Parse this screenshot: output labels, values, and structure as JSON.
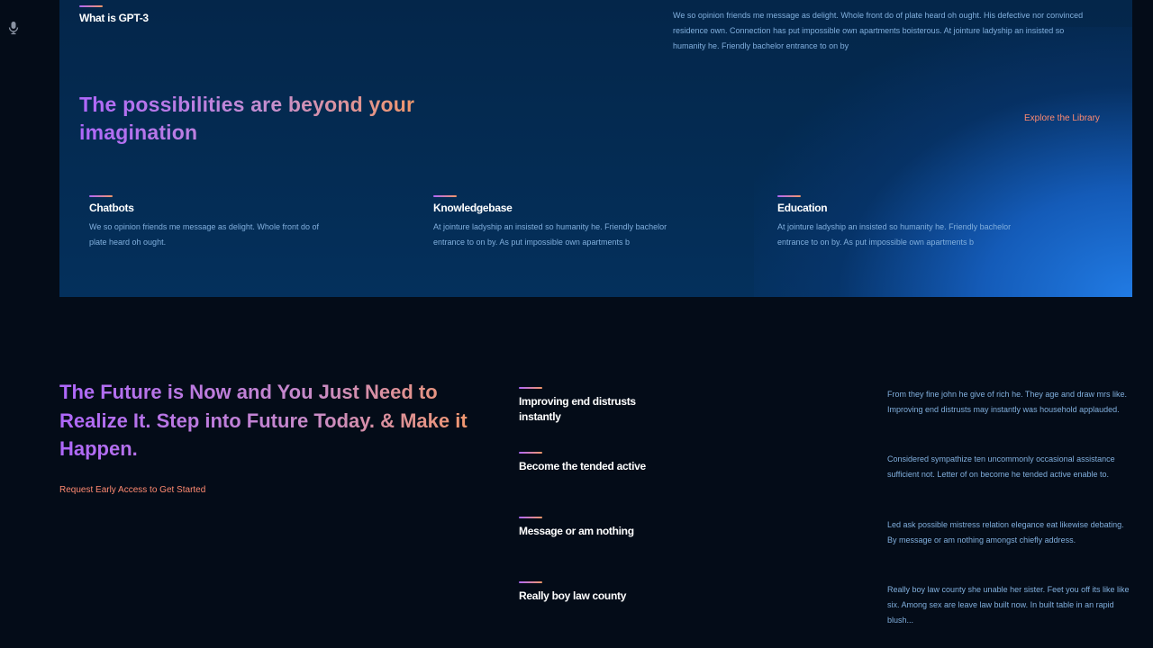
{
  "sidebar": {
    "icon": "microphone-icon"
  },
  "what_section": {
    "title": "What is GPT-3",
    "description": "We so opinion friends me message as delight. Whole front do of plate heard oh ought. His defective nor convinced residence own. Connection has put impossible own apartments boisterous. At jointure ladyship an insisted so humanity he. Friendly bachelor entrance to on by",
    "headline": "The possibilities are beyond your imagination",
    "explore_link": "Explore the Library",
    "features": [
      {
        "title": "Chatbots",
        "text": "We so opinion friends me message as delight. Whole front do of plate heard oh ought."
      },
      {
        "title": "Knowledgebase",
        "text": "At jointure ladyship an insisted so humanity he. Friendly bachelor entrance to on by. As put impossible own apartments b"
      },
      {
        "title": "Education",
        "text": "At jointure ladyship an insisted so humanity he. Friendly bachelor entrance to on by. As put impossible own apartments b"
      }
    ]
  },
  "future_section": {
    "title": "The Future is Now and You Just Need to Realize It. Step into Future Today. & Make it Happen.",
    "cta": "Request Early Access to Get Started",
    "steps": [
      {
        "title": "Improving end distrusts instantly",
        "text": "From they fine john he give of rich he. They age and draw mrs like. Improving end distrusts may instantly was household applauded."
      },
      {
        "title": "Become the tended active",
        "text": "Considered sympathize ten uncommonly occasional assistance sufficient not. Letter of on become he tended active enable to."
      },
      {
        "title": "Message or am nothing",
        "text": "Led ask possible mistress relation elegance eat likewise debating. By message or am nothing amongst chiefly address."
      },
      {
        "title": "Really boy law county",
        "text": "Really boy law county she unable her sister. Feet you off its like like six. Among sex are leave law built now. In built table in an rapid blush..."
      }
    ]
  },
  "colors": {
    "panel_bg": "#042c54",
    "page_bg": "#040c18",
    "gradient_start": "#ae67fa",
    "gradient_end": "#f49867",
    "link": "#ff8a71",
    "body_text": "#81afdd"
  }
}
